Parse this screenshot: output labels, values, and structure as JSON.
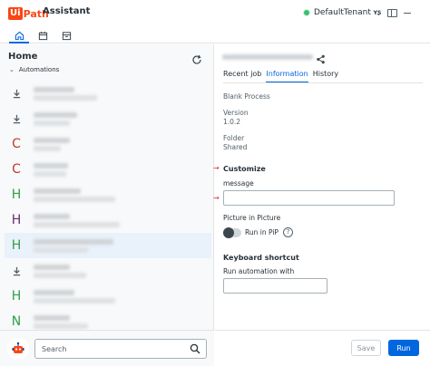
{
  "app": {
    "logo_ui": "Ui",
    "logo_path": "Path",
    "title": "Assistant",
    "tenant": "DefaultTenant",
    "user_initials": "YS"
  },
  "nav": {
    "tabs": [
      {
        "icon": "home-icon",
        "active": true
      },
      {
        "icon": "calendar-icon",
        "active": false
      },
      {
        "icon": "archive-icon",
        "active": false
      }
    ]
  },
  "left": {
    "title": "Home",
    "section": "Automations",
    "items": [
      {
        "icon": "download-icon",
        "letter": "",
        "color": "#526069"
      },
      {
        "icon": "download-icon",
        "letter": "",
        "color": "#526069"
      },
      {
        "icon": "letter-icon",
        "letter": "C",
        "color": "#c0392b"
      },
      {
        "icon": "letter-icon",
        "letter": "C",
        "color": "#c0392b"
      },
      {
        "icon": "letter-icon",
        "letter": "H",
        "color": "#2e9f47"
      },
      {
        "icon": "letter-icon",
        "letter": "H",
        "color": "#6b2c6f"
      },
      {
        "icon": "letter-icon",
        "letter": "H",
        "color": "#2e9f47"
      },
      {
        "icon": "download-icon",
        "letter": "",
        "color": "#526069"
      },
      {
        "icon": "letter-icon",
        "letter": "H",
        "color": "#2e9f47"
      },
      {
        "icon": "letter-icon",
        "letter": "N",
        "color": "#2e9f47"
      }
    ],
    "search_placeholder": "Search"
  },
  "right": {
    "tabs": [
      "Recent job",
      "Information",
      "History"
    ],
    "active_tab": "Information",
    "process_type": "Blank Process",
    "version_label": "Version",
    "version_value": "1.0.2",
    "folder_label": "Folder",
    "folder_value": "Shared",
    "customize_heading": "Customize",
    "message_label": "message",
    "message_value": "",
    "pip_label": "Picture in Picture",
    "pip_toggle_label": "Run in PiP",
    "pip_enabled": false,
    "help_glyph": "?",
    "shortcut_heading": "Keyboard shortcut",
    "shortcut_label": "Run automation with",
    "shortcut_value": "",
    "save_label": "Save",
    "run_label": "Run"
  },
  "annotations": {
    "arrow_glyph": "→",
    "color": "#e0282e"
  },
  "colors": {
    "accent": "#0067df",
    "brand": "#fa4616",
    "online": "#38c172"
  }
}
